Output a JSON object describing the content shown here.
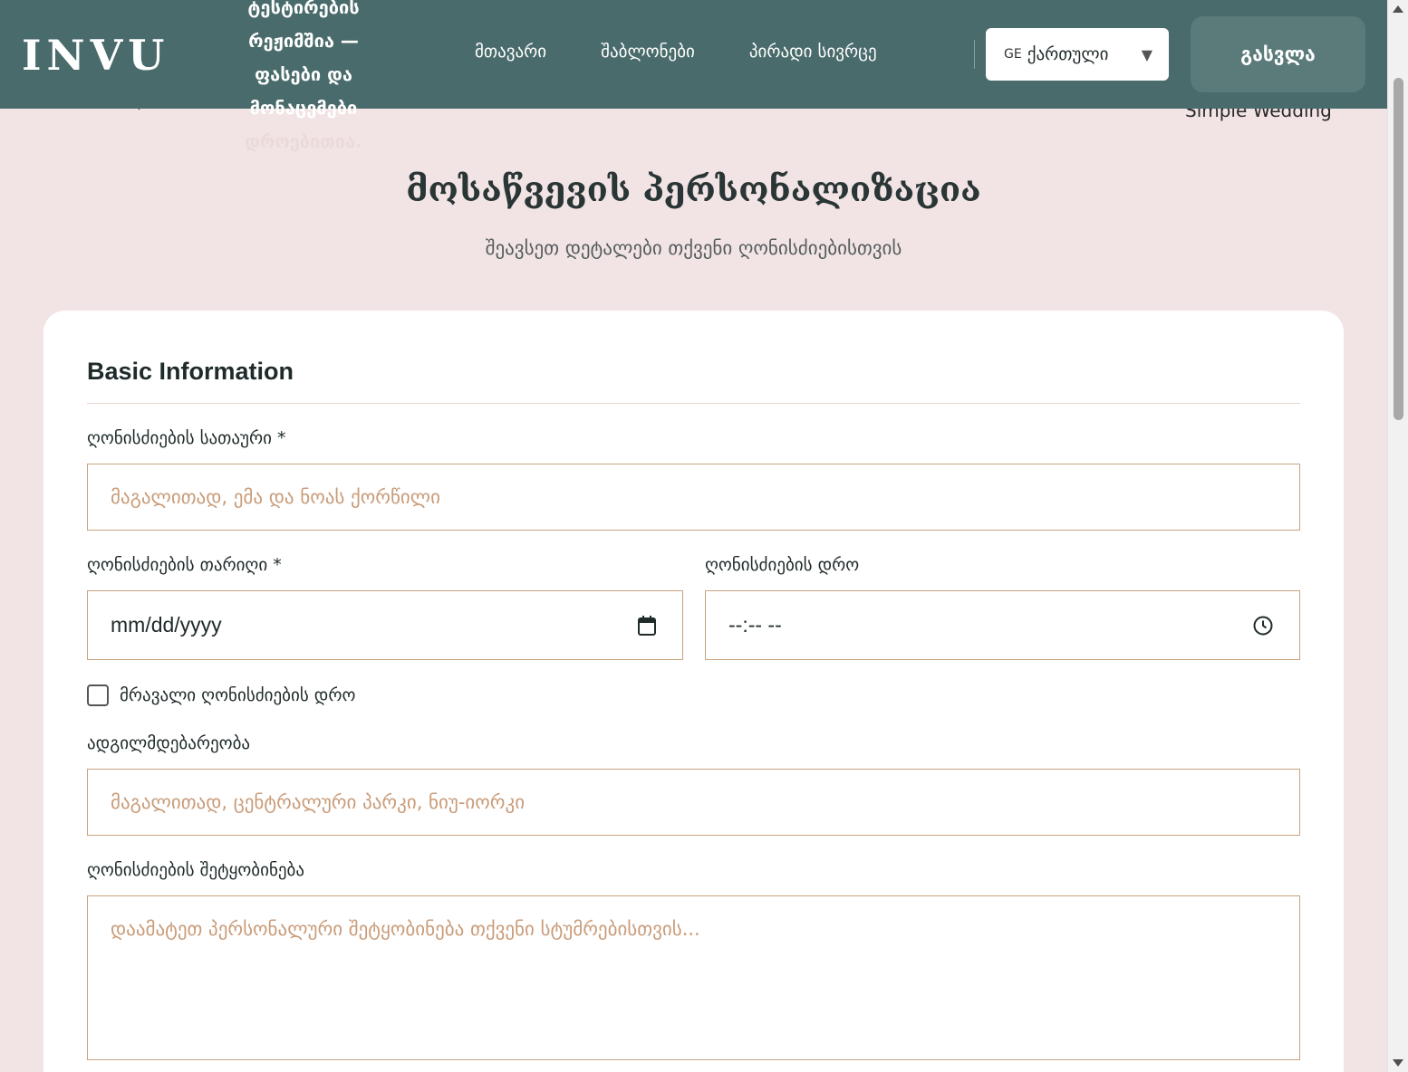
{
  "header": {
    "logo": "INVU",
    "test_notice_main": "ტესტირების რეჟიმშია — ფასები და მონაცემები",
    "test_notice_tail": "დროებითია.",
    "nav": [
      "მთავარი",
      "შაბლონები",
      "პირადი სივრცე"
    ],
    "language": {
      "code": "GE",
      "label": "ქართული"
    },
    "logout_label": "გასვლა"
  },
  "behind": {
    "template_name": "Simple Wedding"
  },
  "page": {
    "title": "მოსაწვევის პერსონალიზაცია",
    "subtitle": "შეავსეთ დეტალები თქვენი ღონისძიებისთვის"
  },
  "form": {
    "section_title": "Basic Information",
    "event_title": {
      "label": "ღონისძიების სათაური *",
      "placeholder": "მაგალითად, ემა და ნოას ქორწილი"
    },
    "event_date": {
      "label": "ღონისძიების თარიღი *",
      "value": "mm/dd/yyyy"
    },
    "event_time": {
      "label": "ღონისძიების დრო",
      "value": "--:-- --"
    },
    "multiple_times": {
      "label": "მრავალი ღონისძიების დრო",
      "checked": false
    },
    "location": {
      "label": "ადგილმდებარეობა",
      "placeholder": "მაგალითად, ცენტრალური პარკი, ნიუ-იორკი"
    },
    "message": {
      "label": "ღონისძიების შეტყობინება",
      "placeholder": "დაამატეთ პერსონალური შეტყობინება თქვენი სტუმრებისთვის..."
    }
  },
  "icons": {
    "date": "calendar-icon",
    "time": "clock-icon",
    "language": "caret-down-icon"
  },
  "colors": {
    "header_bg": "#4a6b6b",
    "page_bg": "#f2e4e5",
    "field_border": "#c9a37f",
    "placeholder": "#c99b78"
  }
}
